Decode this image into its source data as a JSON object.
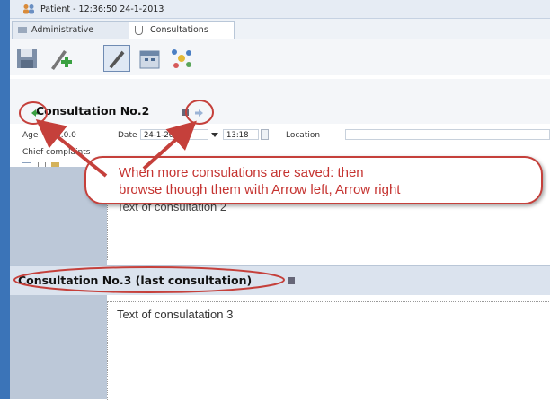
{
  "window": {
    "title": "Patient - 12:36:50 24-1-2013"
  },
  "tabs": [
    {
      "label": "Administrative"
    },
    {
      "label": "Consultations"
    }
  ],
  "consultation2": {
    "title": "Consultation No.2",
    "age_label": "Age",
    "age_value": "0.0.0",
    "date_label": "Date",
    "date_value": "24-1-2013",
    "time_value": "13:18",
    "location_label": "Location",
    "chief_label": "Chief complaints",
    "text": "Text of consultation 2"
  },
  "consultation3": {
    "title": "Consultation No.3 (last consultation)",
    "text": "Text of consulatation 3"
  },
  "callout": {
    "line1": "When more consulations are saved: then",
    "line2": "browse though them with Arrow left, Arrow right"
  },
  "colors": {
    "annotation": "#c5403b",
    "frame": "#3b74b8"
  }
}
